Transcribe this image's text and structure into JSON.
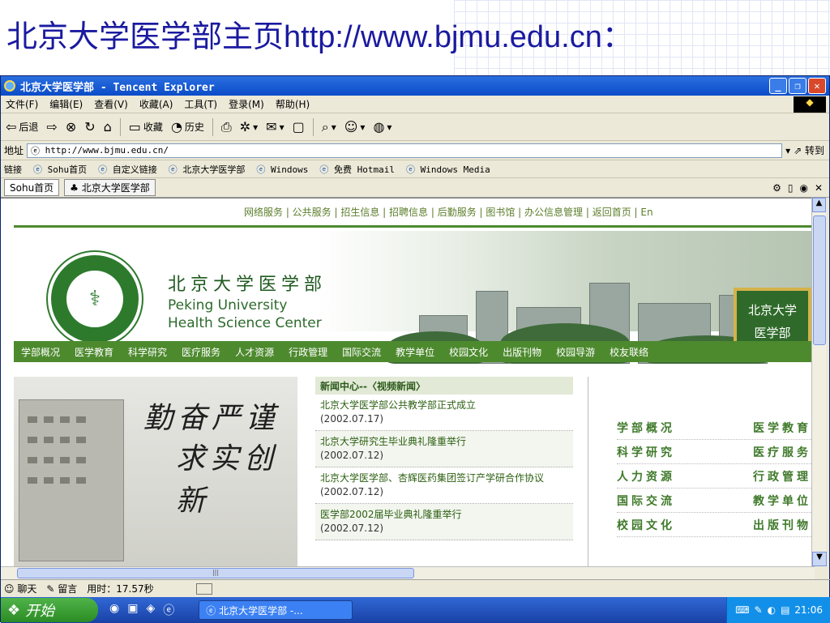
{
  "slide": {
    "title": "北京大学医学部主页http://www.bjmu.edu.cn："
  },
  "window": {
    "title": "北京大学医学部 - Tencent Explorer"
  },
  "menu": [
    "文件(F)",
    "编辑(E)",
    "查看(V)",
    "收藏(A)",
    "工具(T)",
    "登录(M)",
    "帮助(H)"
  ],
  "toolbar": {
    "back": "后退",
    "favorites": "收藏",
    "history": "历史"
  },
  "address": {
    "label": "地址",
    "url": "http://www.bjmu.edu.cn/",
    "go": "转到"
  },
  "links": {
    "label": "链接",
    "items": [
      "Sohu首页",
      "自定义链接",
      "北京大学医学部",
      "Windows",
      "免费 Hotmail",
      "Windows Media"
    ]
  },
  "tabs": [
    "Sohu首页",
    "北京大学医学部"
  ],
  "page": {
    "topnav": "网络服务 | 公共服务 | 招生信息 | 招聘信息 | 后勤服务 | 图书馆 | 办公信息管理 | 返回首页 | En",
    "banner_cn": "北京大学医学部",
    "banner_en1": "Peking University",
    "banner_en2": "Health Science Center",
    "logo_year": "1912",
    "sign": [
      "北京大学",
      "医学部"
    ],
    "mainnav": [
      "学部概况",
      "医学教育",
      "科学研究",
      "医疗服务",
      "人才资源",
      "行政管理",
      "国际交流",
      "教学单位",
      "校园文化",
      "出版刊物",
      "校园导游",
      "校友联络"
    ],
    "motto1": "勤奋严谨",
    "motto2": "求实创新",
    "news_head": "新闻中心--〈视频新闻〉",
    "news": [
      {
        "title": "北京大学医学部公共教学部正式成立",
        "date": "(2002.07.17)"
      },
      {
        "title": "北京大学研究生毕业典礼隆重举行",
        "date": "(2002.07.12)"
      },
      {
        "title": "北京大学医学部、杏辉医药集团签订产学研合作协议",
        "date": "(2002.07.12)"
      },
      {
        "title": "医学部2002届毕业典礼隆重举行",
        "date": "(2002.07.12)"
      }
    ],
    "quick": [
      [
        "学部概况",
        "医学教育"
      ],
      [
        "科学研究",
        "医疗服务"
      ],
      [
        "人力资源",
        "行政管理"
      ],
      [
        "国际交流",
        "教学单位"
      ],
      [
        "校园文化",
        "出版刊物"
      ]
    ]
  },
  "status": {
    "chat": "聊天",
    "message": "留言",
    "time": "用时：17.57秒"
  },
  "taskbar": {
    "start": "开始",
    "task": "北京大学医学部 -...",
    "clock": "21:06"
  }
}
